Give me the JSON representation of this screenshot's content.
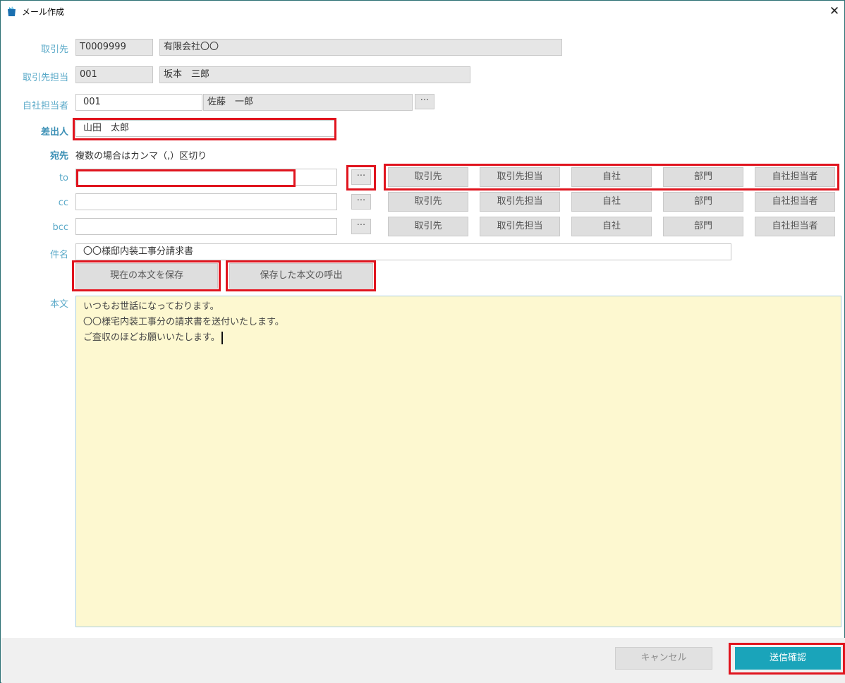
{
  "window": {
    "title": "メール作成",
    "close_glyph": "✕"
  },
  "labels": {
    "client": "取引先",
    "client_contact": "取引先担当",
    "own_staff": "自社担当者",
    "sender": "差出人",
    "recipient": "宛先",
    "recipient_hint": "複数の場合はカンマ（,）区切り",
    "to": "to",
    "cc": "cc",
    "bcc": "bcc",
    "subject": "件名",
    "body": "本文"
  },
  "fields": {
    "client_code": "T0009999",
    "client_name": "有限会社〇〇",
    "contact_code": "001",
    "contact_name": "坂本　三郎",
    "staff_code": "001",
    "staff_name": "佐藤　一郎",
    "sender": "山田　太郎",
    "to": "",
    "cc": "",
    "bcc": "",
    "subject": "〇〇様邸内装工事分請求書"
  },
  "dots_label": "···",
  "recipient_buttons": [
    "取引先",
    "取引先担当",
    "自社",
    "部門",
    "自社担当者"
  ],
  "template_buttons": {
    "save": "現在の本文を保存",
    "load": "保存した本文の呼出"
  },
  "body_lines": [
    "いつもお世話になっております。",
    "〇〇様宅内装工事分の請求書を送付いたします。",
    "ご査収のほどお願いいたします。"
  ],
  "footer": {
    "cancel": "キャンセル",
    "confirm": "送信確認"
  },
  "colors": {
    "accent": "#1aa4ba",
    "highlight": "#e0141e",
    "body_bg": "#fdf8d0",
    "label": "#5aa9c8"
  }
}
